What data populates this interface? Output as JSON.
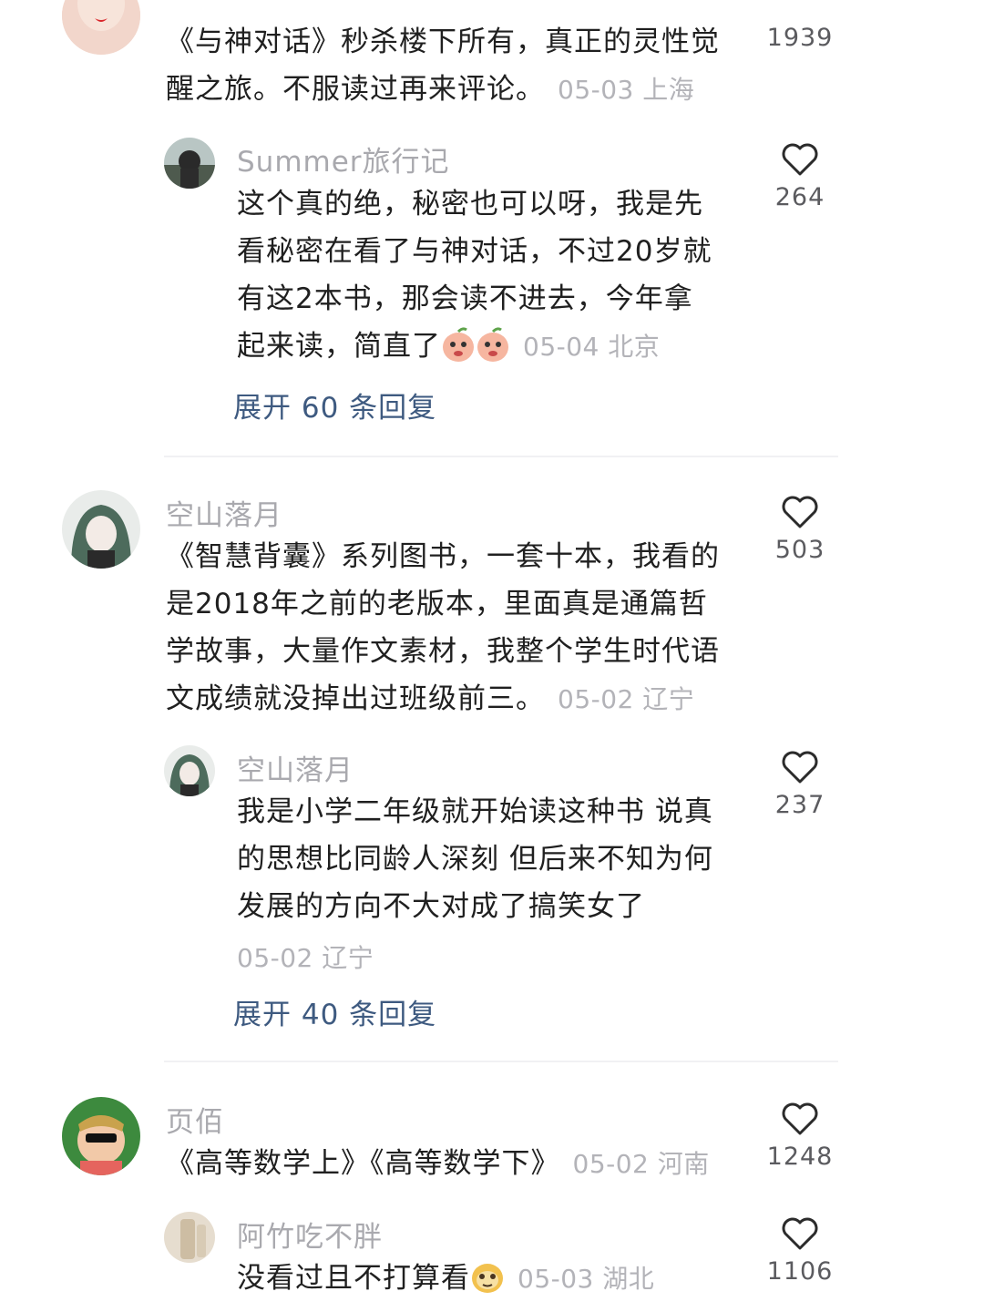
{
  "comments": [
    {
      "text_lines": [
        "《与神对话》秒杀楼下所有，真正的灵性觉",
        "醒之旅。不服读过再来评论。"
      ],
      "meta": "05-03 上海",
      "likes": "1939"
    },
    {
      "username": "Summer旅行记",
      "text_lines": [
        "这个真的绝，秘密也可以呀，我是先",
        "看秘密在看了与神对话，不过20岁就",
        "有这2本书，那会读不进去，今年拿",
        "起来读，简直了"
      ],
      "meta": "05-04 北京",
      "likes": "264",
      "emoji": "peach-emoji"
    },
    {
      "username": "空山落月",
      "text_lines": [
        "《智慧背囊》系列图书，一套十本，我看的",
        "是2018年之前的老版本，里面真是通篇哲",
        "学故事，大量作文素材，我整个学生时代语",
        "文成绩就没掉出过班级前三。"
      ],
      "meta": "05-02 辽宁",
      "likes": "503"
    },
    {
      "username": "空山落月",
      "text_lines": [
        "我是小学二年级就开始读这种书 说真",
        "的思想比同龄人深刻 但后来不知为何",
        "发展的方向不大对成了搞笑女了"
      ],
      "meta": "05-02 辽宁",
      "likes": "237"
    },
    {
      "username": "页佰",
      "text_lines": [
        "《高等数学上》《高等数学下》"
      ],
      "meta": "05-02 河南",
      "likes": "1248"
    },
    {
      "username": "阿竹吃不胖",
      "text_lines": [
        "没看过且不打算看"
      ],
      "meta": "05-03 湖北",
      "likes": "1106",
      "emoji": "sloth-emoji"
    }
  ],
  "expand_replies": [
    "展开 60 条回复",
    "展开 40 条回复"
  ],
  "colors": {
    "username": "#a9a9ae",
    "meta": "#b3b3b8",
    "expand_link": "#3e5a80",
    "divider": "#f1f1f3"
  }
}
